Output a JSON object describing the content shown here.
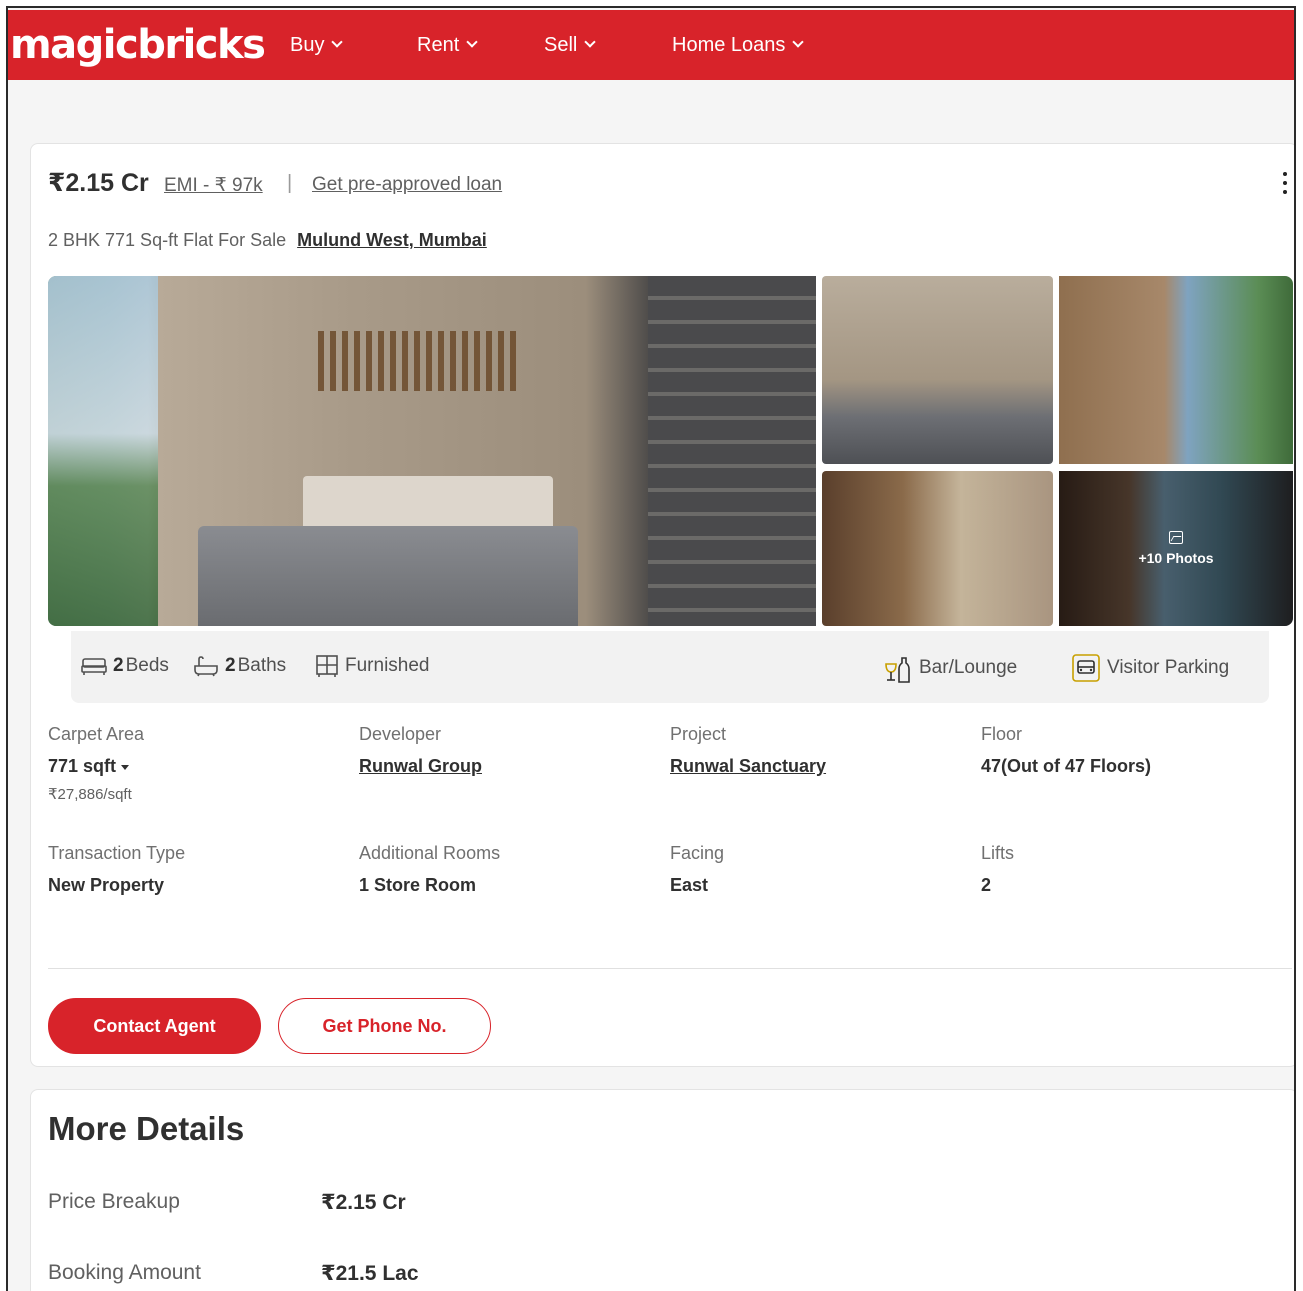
{
  "header": {
    "logo": "magicbricks",
    "nav": [
      {
        "label": "Buy"
      },
      {
        "label": "Rent"
      },
      {
        "label": "Sell"
      },
      {
        "label": "Home Loans"
      }
    ],
    "brand_color": "#d8232a"
  },
  "listing": {
    "price": "₹2.15 Cr",
    "emi": "EMI - ₹ 97k",
    "separator": "|",
    "loan_link": "Get pre-approved loan",
    "title": "2 BHK 771 Sq-ft Flat For Sale",
    "location": "Mulund West, Mumbai",
    "gallery": {
      "more_photos": "+10 Photos"
    },
    "amenities": {
      "beds_count": "2",
      "beds_label": "Beds",
      "baths_count": "2",
      "baths_label": "Baths",
      "furnishing": "Furnished",
      "bar": "Bar/Lounge",
      "parking": "Visitor Parking"
    },
    "details": [
      {
        "label": "Carpet Area",
        "value": "771 sqft",
        "sub": "₹27,886/sqft"
      },
      {
        "label": "Developer",
        "value": "Runwal Group"
      },
      {
        "label": "Project",
        "value": "Runwal Sanctuary"
      },
      {
        "label": "Floor",
        "value": "47(Out of 47 Floors)"
      },
      {
        "label": "Transaction Type",
        "value": "New Property"
      },
      {
        "label": "Additional Rooms",
        "value": "1 Store Room"
      },
      {
        "label": "Facing",
        "value": "East"
      },
      {
        "label": "Lifts",
        "value": "2"
      }
    ],
    "buttons": {
      "contact": "Contact Agent",
      "phone": "Get Phone No."
    }
  },
  "more_details": {
    "title": "More Details",
    "rows": [
      {
        "label": "Price Breakup",
        "value": "₹2.15 Cr"
      },
      {
        "label": "Booking Amount",
        "value": "₹21.5 Lac"
      }
    ]
  }
}
